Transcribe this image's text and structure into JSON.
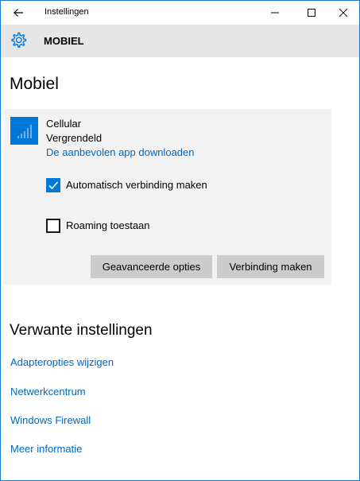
{
  "window": {
    "title": "Instellingen"
  },
  "header": {
    "title": "MOBIEL"
  },
  "page": {
    "title": "Mobiel"
  },
  "network": {
    "name": "Cellular",
    "status": "Vergrendeld",
    "link": "De aanbevolen app downloaden",
    "auto_connect": {
      "label": "Automatisch verbinding maken",
      "checked": true
    },
    "roaming": {
      "label": "Roaming toestaan",
      "checked": false
    },
    "buttons": {
      "advanced": "Geavanceerde opties",
      "connect": "Verbinding maken"
    }
  },
  "related": {
    "title": "Verwante instellingen",
    "links": [
      "Adapteropties wijzigen",
      "Netwerkcentrum",
      "Windows Firewall",
      "Meer informatie"
    ]
  },
  "colors": {
    "accent": "#0078d7",
    "link": "#0067c0",
    "header_bg": "#e6e6e6",
    "card_bg": "#f2f2f2",
    "button_bg": "#cccccc"
  },
  "icons": {
    "back": "back-arrow-icon",
    "settings": "gear-icon",
    "signal": "cellular-signal-icon"
  }
}
